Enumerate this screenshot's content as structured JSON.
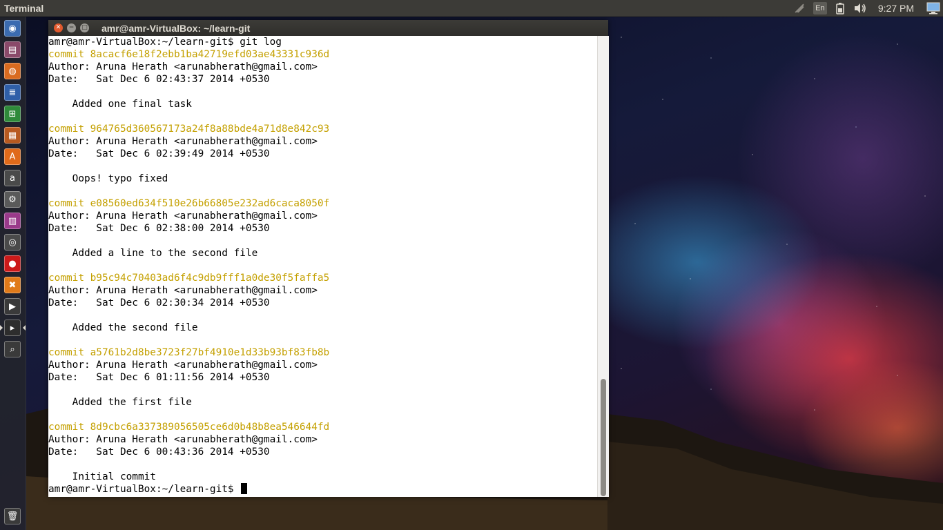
{
  "panel": {
    "app_title": "Terminal",
    "clock": "9:27 PM",
    "keyboard_layout": "En"
  },
  "launcher": {
    "items": [
      {
        "name": "dash-home",
        "glyph": "◉",
        "color": "#3b6bb0"
      },
      {
        "name": "files",
        "glyph": "▤",
        "color": "#8a4a6a"
      },
      {
        "name": "firefox",
        "glyph": "◍",
        "color": "#d96b20"
      },
      {
        "name": "libreoffice-writer",
        "glyph": "≣",
        "color": "#2f5fa8"
      },
      {
        "name": "libreoffice-calc",
        "glyph": "⊞",
        "color": "#2f8a3a"
      },
      {
        "name": "libreoffice-impress",
        "glyph": "▦",
        "color": "#b85a20"
      },
      {
        "name": "ubuntu-software-center",
        "glyph": "A",
        "color": "#e06a1a"
      },
      {
        "name": "amazon",
        "glyph": "a",
        "color": "#4a4a4a"
      },
      {
        "name": "system-settings",
        "glyph": "⚙",
        "color": "#5a5a5a"
      },
      {
        "name": "workspace-switcher",
        "glyph": "▥",
        "color": "#9a3a8a"
      },
      {
        "name": "disk-utility",
        "glyph": "◎",
        "color": "#4a4a4a"
      },
      {
        "name": "record",
        "glyph": "●",
        "color": "#cc1a1a"
      },
      {
        "name": "xampp",
        "glyph": "✖",
        "color": "#e07a1a"
      },
      {
        "name": "youtube",
        "glyph": "▶",
        "color": "#3a3a3a"
      },
      {
        "name": "terminal",
        "glyph": "▸",
        "color": "#2d2d2d"
      },
      {
        "name": "search-tool",
        "glyph": "⌕",
        "color": "#3a3a3a"
      }
    ],
    "trash": {
      "name": "trash",
      "glyph": "🗑",
      "color": "#3a3a3a"
    }
  },
  "terminal": {
    "title": "amr@amr-VirtualBox: ~/learn-git",
    "lines": [
      {
        "text": "amr@amr-VirtualBox:~/learn-git$ git log",
        "type": "prompt"
      },
      {
        "text": "commit 8acacf6e18f2ebb1ba42719efd03ae43331c936d",
        "type": "commit"
      },
      {
        "text": "Author: Aruna Herath <arunabherath@gmail.com>",
        "type": "normal"
      },
      {
        "text": "Date:   Sat Dec 6 02:43:37 2014 +0530",
        "type": "normal"
      },
      {
        "text": "",
        "type": "normal"
      },
      {
        "text": "    Added one final task",
        "type": "normal"
      },
      {
        "text": "",
        "type": "normal"
      },
      {
        "text": "commit 964765d360567173a24f8a88bde4a71d8e842c93",
        "type": "commit"
      },
      {
        "text": "Author: Aruna Herath <arunabherath@gmail.com>",
        "type": "normal"
      },
      {
        "text": "Date:   Sat Dec 6 02:39:49 2014 +0530",
        "type": "normal"
      },
      {
        "text": "",
        "type": "normal"
      },
      {
        "text": "    Oops! typo fixed",
        "type": "normal"
      },
      {
        "text": "",
        "type": "normal"
      },
      {
        "text": "commit e08560ed634f510e26b66805e232ad6caca8050f",
        "type": "commit"
      },
      {
        "text": "Author: Aruna Herath <arunabherath@gmail.com>",
        "type": "normal"
      },
      {
        "text": "Date:   Sat Dec 6 02:38:00 2014 +0530",
        "type": "normal"
      },
      {
        "text": "",
        "type": "normal"
      },
      {
        "text": "    Added a line to the second file",
        "type": "normal"
      },
      {
        "text": "",
        "type": "normal"
      },
      {
        "text": "commit b95c94c70403ad6f4c9db9fff1a0de30f5faffa5",
        "type": "commit"
      },
      {
        "text": "Author: Aruna Herath <arunabherath@gmail.com>",
        "type": "normal"
      },
      {
        "text": "Date:   Sat Dec 6 02:30:34 2014 +0530",
        "type": "normal"
      },
      {
        "text": "",
        "type": "normal"
      },
      {
        "text": "    Added the second file",
        "type": "normal"
      },
      {
        "text": "",
        "type": "normal"
      },
      {
        "text": "commit a5761b2d8be3723f27bf4910e1d33b93bf83fb8b",
        "type": "commit"
      },
      {
        "text": "Author: Aruna Herath <arunabherath@gmail.com>",
        "type": "normal"
      },
      {
        "text": "Date:   Sat Dec 6 01:11:56 2014 +0530",
        "type": "normal"
      },
      {
        "text": "",
        "type": "normal"
      },
      {
        "text": "    Added the first file",
        "type": "normal"
      },
      {
        "text": "",
        "type": "normal"
      },
      {
        "text": "commit 8d9cbc6a337389056505ce6d0b48b8ea546644fd",
        "type": "commit"
      },
      {
        "text": "Author: Aruna Herath <arunabherath@gmail.com>",
        "type": "normal"
      },
      {
        "text": "Date:   Sat Dec 6 00:43:36 2014 +0530",
        "type": "normal"
      },
      {
        "text": "",
        "type": "normal"
      },
      {
        "text": "    Initial commit",
        "type": "normal"
      },
      {
        "text": "amr@amr-VirtualBox:~/learn-git$ ",
        "type": "cursor"
      }
    ]
  },
  "colors": {
    "commit_hash": "#c4a000",
    "terminal_bg": "#ffffff",
    "panel_bg": "#3c3b37"
  }
}
